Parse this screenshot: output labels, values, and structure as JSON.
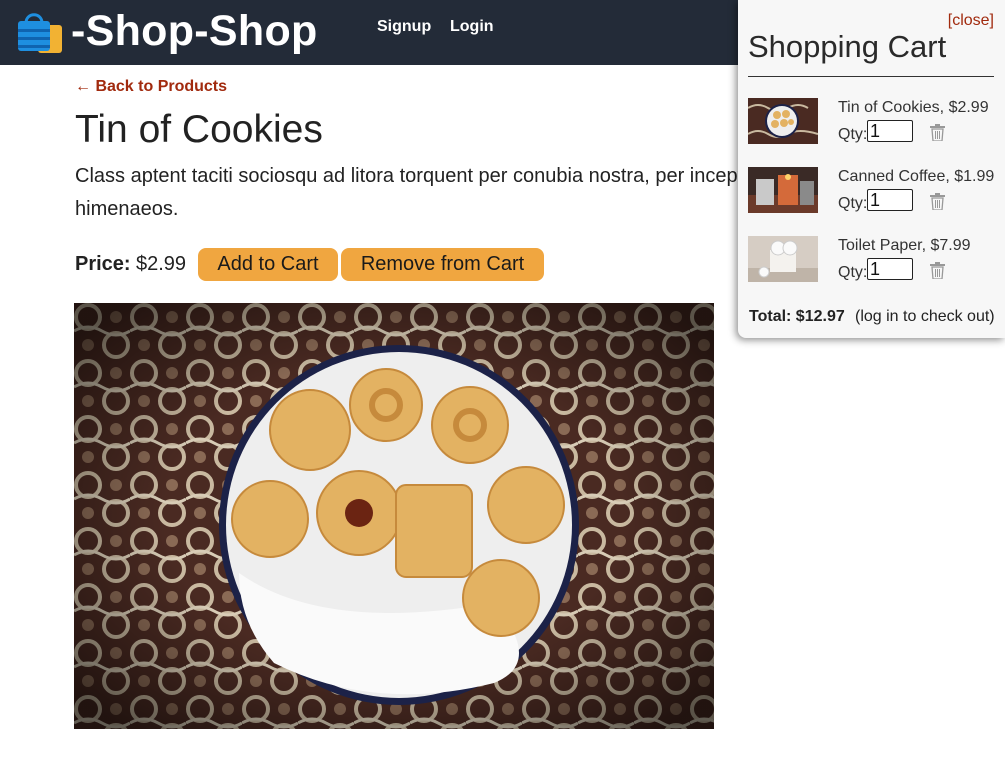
{
  "header": {
    "brand": "-Shop-Shop",
    "nav": {
      "signup": "Signup",
      "login": "Login"
    }
  },
  "product": {
    "back_link": "← Back to Products",
    "title": "Tin of Cookies",
    "description": "Class aptent taciti sociosqu ad litora torquent per conubia nostra, per inceptos himenaeos.",
    "price_label": "Price:",
    "price": "$2.99",
    "add_button": "Add to Cart",
    "remove_button": "Remove from Cart"
  },
  "cart": {
    "close_label": "[close]",
    "title": "Shopping Cart",
    "qty_label": "Qty:",
    "items": [
      {
        "name": "Tin of Cookies, $2.99",
        "qty": "1",
        "thumb": "cookie-tin-thumbnail"
      },
      {
        "name": "Canned Coffee, $1.99",
        "qty": "1",
        "thumb": "canned-coffee-thumbnail"
      },
      {
        "name": "Toilet Paper, $7.99",
        "qty": "1",
        "thumb": "toilet-paper-thumbnail"
      }
    ],
    "total": "Total: $12.97",
    "checkout_note": "(log in to check out)"
  },
  "colors": {
    "header_bg": "#232b38",
    "button_bg": "#f0a640",
    "link": "#a12a0e",
    "cart_bg": "#f7f7f7"
  },
  "icons": [
    "shopping-bag-icon",
    "trash-icon"
  ]
}
